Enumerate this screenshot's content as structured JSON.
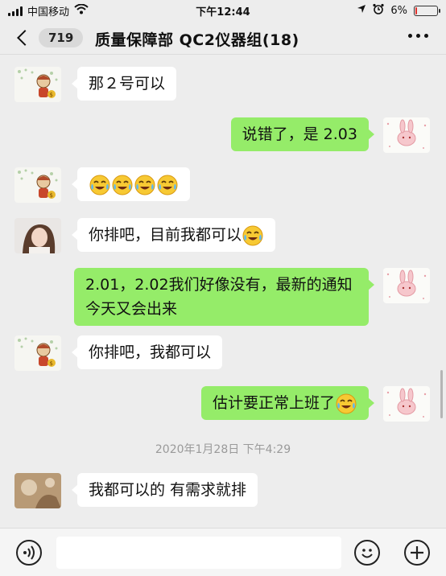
{
  "status_bar": {
    "carrier": "中国移动",
    "time": "下午12:44",
    "battery": "6%",
    "battery_level": 0.06,
    "icons": [
      "signal-icon",
      "wifi-icon",
      "location-icon",
      "alarm-icon",
      "battery-icon"
    ]
  },
  "nav": {
    "unread_count": "719",
    "title": "质量保障部 QC2仪器组(18)",
    "icons": [
      "back-chevron-icon",
      "more-icon"
    ]
  },
  "messages": [
    {
      "sender": "other",
      "avatar": "cartoon-avatar",
      "text": "那２号可以"
    },
    {
      "sender": "self",
      "avatar": "bunny-avatar",
      "text": "说错了，是 2.03"
    },
    {
      "sender": "other",
      "avatar": "cartoon-avatar",
      "text": "",
      "emoji": [
        "crying-laughing-emoji",
        "crying-laughing-emoji",
        "crying-laughing-emoji",
        "crying-laughing-emoji"
      ]
    },
    {
      "sender": "other",
      "avatar": "girl-photo-avatar",
      "text": "你排吧，目前我都可以",
      "emoji": [
        "crying-laughing-emoji"
      ]
    },
    {
      "sender": "self",
      "avatar": "bunny-avatar",
      "text": "2.01，2.02我们好像没有，最新的通知今天又会出来"
    },
    {
      "sender": "other",
      "avatar": "cartoon-avatar",
      "text": "你排吧，我都可以"
    },
    {
      "sender": "self",
      "avatar": "bunny-avatar",
      "text": "估计要正常上班了",
      "emoji": [
        "crying-laughing-emoji"
      ]
    },
    {
      "sender": "other",
      "avatar": "photo-avatar",
      "text": "我都可以的  有需求就排"
    }
  ],
  "timestamp": "2020年1月28日 下午4:29",
  "input_bar": {
    "value": "",
    "icons": [
      "voice-icon",
      "emoji-icon",
      "plus-icon"
    ]
  }
}
